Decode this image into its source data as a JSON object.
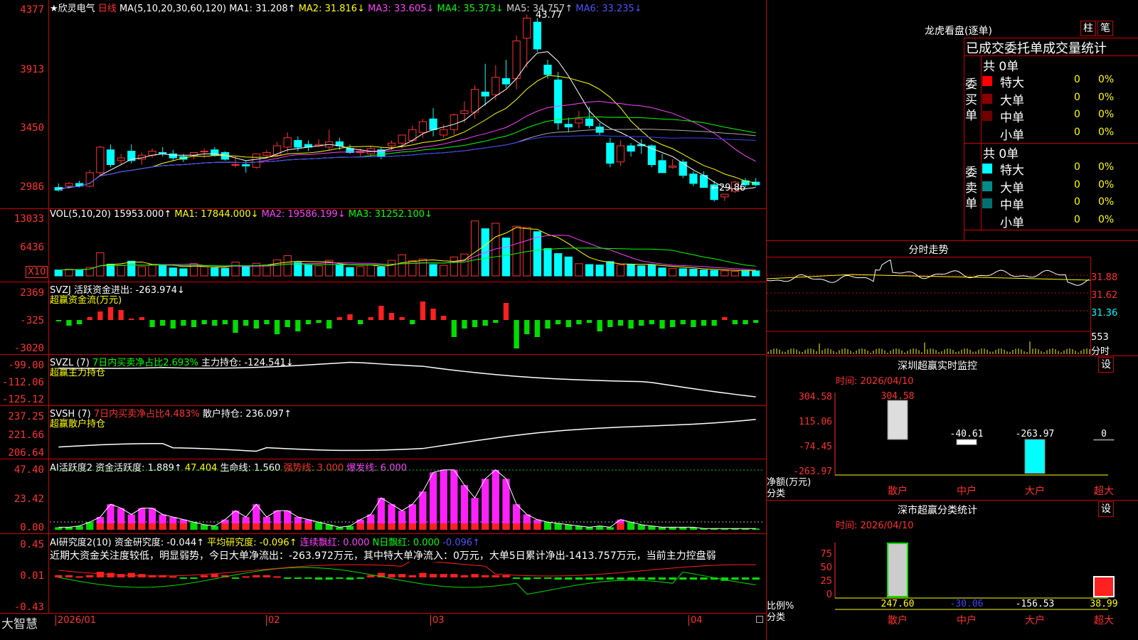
{
  "chart": {
    "stock_name": "★欣灵电气",
    "period": "日线",
    "ma_line": {
      "label": "MA(5,10,20,30,60,120)",
      "ma1": "MA1: 31.208↑",
      "ma2": "MA2: 31.816↓",
      "ma3": "MA3: 33.605↓",
      "ma4": "MA4: 35.373↓",
      "ma5": "MA5: 34.757↑",
      "ma6": "MA6: 33.235↓"
    },
    "high_mark": "43.77",
    "low_mark": "←29.86",
    "price_axis": [
      "4377",
      "3913",
      "3450",
      "2986"
    ],
    "vol_line": {
      "label": "VOL(5,10,20)",
      "v": "15953.000↑",
      "ma1": "MA1: 17844.000↓",
      "ma2": "MA2: 19586.199↓",
      "ma3": "MA3: 31252.100↓"
    },
    "vol_axis": [
      "13033",
      "6436",
      "X10"
    ],
    "svzj": {
      "label": "SVZJ",
      "desc": "活跃资金进出: -263.974↓",
      "sub": "超赢资金流(万元)",
      "axis": [
        "2369",
        "-325",
        "-3020"
      ]
    },
    "svzl": {
      "label": "SVZL (7)",
      "ratio": "7日内买卖净占比2.693%",
      "hold": "主力持仓: -124.541↓",
      "sub": "超赢主力持仓",
      "axis": [
        "-99.00",
        "-112.06",
        "-125.12"
      ]
    },
    "svsh": {
      "label": "SVSH (7)",
      "ratio": "7日内买卖净占比4.483%",
      "hold": "散户持仓: 236.097↑",
      "sub": "超赢散户持仓",
      "axis": [
        "237.25",
        "221.66",
        "206.64"
      ]
    },
    "ai_active": {
      "label": "AI活跃度2",
      "v1": "资金活跃度: 1.889↑",
      "v2": "47.404",
      "v3": "生命线: 1.560",
      "v4": "强势线: 3.000",
      "v5": "爆发线: 6.000",
      "axis": [
        "47.40",
        "23.42",
        "0.00"
      ]
    },
    "ai_research": {
      "label": "AI研究度2(10)",
      "v1": "资金研究度: -0.044↑",
      "v2": "平均研究度: -0.096↑",
      "v3": "连续飘红: 0.000",
      "v4": "N日飘红: 0.000",
      "v5": "-0.096↑",
      "axis": [
        "0.45",
        "0.01",
        "-0.43"
      ],
      "note": "近期大资金关注度较低，明显弱势，今日大单净流出：-263.972万元，其中特大单净流入：0万元，大单5日累计净出-1413.757万元，当前主力控盘弱"
    },
    "date_axis": [
      "2026/01",
      "02",
      "03",
      "04"
    ],
    "brand": "大智慧"
  },
  "right": {
    "dragon": {
      "title": "龙虎看盘(逐单)",
      "btn1": "柱",
      "btn2": "笔",
      "subtitle": "已成交委托单成交量统计",
      "buy": {
        "side": "委买单",
        "total": "共 0单",
        "rows": [
          {
            "label": "特大",
            "count": "0",
            "pct": "0%",
            "color": "#ff0000"
          },
          {
            "label": "大单",
            "count": "0",
            "pct": "0%",
            "color": "#8b0000"
          },
          {
            "label": "中单",
            "count": "0",
            "pct": "0%",
            "color": "#700000"
          },
          {
            "label": "小单",
            "count": "0",
            "pct": "0%",
            "color": "#000"
          }
        ]
      },
      "sell": {
        "side": "委卖单",
        "total": "共 0单",
        "rows": [
          {
            "label": "特大",
            "count": "0",
            "pct": "0%",
            "color": "#00ffff"
          },
          {
            "label": "大单",
            "count": "0",
            "pct": "0%",
            "color": "#008b8b"
          },
          {
            "label": "中单",
            "count": "0",
            "pct": "0%",
            "color": "#007070"
          },
          {
            "label": "小单",
            "count": "0",
            "pct": "0%",
            "color": "#000"
          }
        ]
      }
    },
    "intraday": {
      "title": "分时走势",
      "axis": [
        "31.88",
        "31.62",
        "31.36"
      ],
      "vol": "553",
      "vol_label": "分时"
    },
    "sz_monitor": {
      "title": "深圳超赢实时监控",
      "btn": "设",
      "time": "时间: 2026/04/10",
      "axis": [
        "304.58",
        "115.06",
        "-74.45",
        "-263.97"
      ],
      "values": [
        {
          "cat": "散户",
          "v": 304.58,
          "label": "304.58"
        },
        {
          "cat": "中户",
          "v": -40.61,
          "label": "-40.61"
        },
        {
          "cat": "大户",
          "v": -263.97,
          "label": "-263.97"
        },
        {
          "cat": "超大",
          "v": 0,
          "label": "0"
        }
      ],
      "ylabel": "净额(万元)",
      "xlabel": "分类"
    },
    "sz_category": {
      "title": "深市超赢分类统计",
      "btn": "设",
      "time": "时间: 2026/04/10",
      "axis": [
        "75",
        "50",
        "25",
        "0"
      ],
      "values": [
        {
          "cat": "散户",
          "v": 247.6,
          "label": "247.60"
        },
        {
          "cat": "中户",
          "v": -30.06,
          "label": "-30.06"
        },
        {
          "cat": "大户",
          "v": -156.53,
          "label": "-156.53"
        },
        {
          "cat": "超大",
          "v": 38.99,
          "label": "38.99"
        }
      ],
      "ylabel": "比例%",
      "xlabel": "分类"
    }
  },
  "chart_data": [
    {
      "type": "candlestick",
      "title": "欣灵电气 日线",
      "ohlc": [
        [
          30.9,
          31.2,
          30.6,
          30.7
        ],
        [
          31.0,
          31.3,
          30.8,
          31.2
        ],
        [
          31.2,
          31.4,
          30.9,
          31.0
        ],
        [
          31.0,
          32.2,
          30.9,
          32.0
        ],
        [
          32.0,
          34.0,
          31.8,
          33.9
        ],
        [
          33.7,
          34.1,
          32.4,
          32.6
        ],
        [
          32.9,
          33.4,
          32.6,
          33.1
        ],
        [
          33.6,
          34.1,
          32.7,
          32.9
        ],
        [
          33.0,
          33.5,
          32.6,
          33.3
        ],
        [
          33.3,
          33.8,
          33.1,
          33.6
        ],
        [
          33.5,
          33.9,
          33.2,
          33.4
        ],
        [
          33.4,
          33.7,
          32.9,
          33.1
        ],
        [
          33.2,
          33.4,
          32.8,
          33.0
        ],
        [
          33.3,
          33.5,
          33.0,
          33.5
        ],
        [
          33.6,
          33.8,
          33.1,
          33.6
        ],
        [
          33.7,
          33.9,
          33.2,
          33.3
        ],
        [
          33.5,
          33.6,
          32.9,
          33.0
        ],
        [
          32.6,
          33.2,
          32.4,
          32.6
        ],
        [
          32.6,
          32.9,
          32.0,
          32.5
        ],
        [
          32.4,
          33.4,
          32.3,
          33.4
        ],
        [
          33.3,
          33.7,
          33.1,
          33.5
        ],
        [
          33.3,
          34.3,
          33.2,
          34.0
        ],
        [
          33.9,
          35.0,
          33.5,
          34.6
        ],
        [
          34.4,
          34.7,
          33.6,
          33.9
        ],
        [
          34.1,
          34.4,
          33.6,
          33.9
        ],
        [
          34.0,
          34.5,
          33.9,
          34.1
        ],
        [
          33.9,
          35.2,
          33.7,
          34.3
        ],
        [
          34.3,
          34.6,
          33.7,
          34.0
        ],
        [
          33.8,
          34.1,
          33.4,
          33.5
        ],
        [
          33.5,
          33.8,
          33.2,
          33.6
        ],
        [
          33.4,
          34.0,
          33.2,
          33.8
        ],
        [
          33.7,
          33.9,
          33.0,
          33.2
        ],
        [
          34.0,
          34.4,
          33.7,
          34.2
        ],
        [
          34.2,
          34.8,
          33.8,
          34.8
        ],
        [
          34.4,
          35.5,
          34.2,
          35.2
        ],
        [
          35.0,
          36.0,
          34.6,
          35.8
        ],
        [
          36.0,
          36.8,
          34.7,
          35.2
        ],
        [
          34.8,
          35.6,
          34.6,
          35.2
        ],
        [
          35.2,
          36.4,
          34.8,
          36.3
        ],
        [
          36.4,
          37.3,
          35.7,
          36.6
        ],
        [
          36.5,
          38.5,
          36.0,
          38.2
        ],
        [
          38.0,
          40.1,
          37.0,
          37.7
        ],
        [
          37.8,
          40.0,
          37.4,
          39.1
        ],
        [
          39.0,
          40.4,
          38.3,
          38.6
        ],
        [
          39.0,
          42.2,
          38.2,
          41.8
        ],
        [
          42.0,
          43.77,
          39.8,
          43.5
        ],
        [
          43.2,
          43.5,
          41.0,
          41.2
        ],
        [
          40.0,
          40.4,
          39.0,
          39.3
        ],
        [
          38.9,
          39.5,
          35.2,
          35.7
        ],
        [
          35.6,
          36.1,
          35.0,
          35.4
        ],
        [
          35.7,
          36.6,
          35.3,
          36.0
        ],
        [
          36.0,
          36.9,
          35.3,
          35.5
        ],
        [
          35.4,
          35.7,
          34.8,
          35.0
        ],
        [
          34.2,
          34.6,
          32.4,
          32.7
        ],
        [
          32.8,
          34.4,
          32.5,
          34.0
        ],
        [
          34.0,
          34.2,
          33.2,
          33.6
        ],
        [
          34.1,
          34.5,
          33.4,
          34.0
        ],
        [
          34.0,
          34.1,
          32.4,
          32.6
        ],
        [
          32.9,
          33.4,
          32.0,
          32.0
        ],
        [
          32.4,
          33.0,
          32.3,
          32.5
        ],
        [
          32.8,
          33.0,
          31.6,
          31.8
        ],
        [
          31.9,
          32.1,
          31.0,
          31.2
        ],
        [
          31.8,
          32.1,
          30.9,
          30.9
        ],
        [
          31.1,
          31.4,
          29.86,
          30.0
        ],
        [
          30.2,
          30.4,
          29.9,
          30.4
        ],
        [
          30.6,
          31.4,
          30.5,
          31.3
        ],
        [
          31.4,
          31.6,
          30.9,
          31.1
        ],
        [
          31.3,
          31.6,
          31.0,
          31.1
        ]
      ],
      "ma": {
        "MA1": [
          30.8,
          30.9,
          31.0,
          31.2,
          31.8,
          32.2,
          32.6,
          33.0,
          33.1,
          33.3,
          33.4,
          33.3,
          33.3,
          33.3,
          33.4,
          33.4,
          33.3,
          33.1,
          32.9,
          33.0,
          33.1,
          33.4,
          33.7,
          33.8,
          33.9,
          34.0,
          34.1,
          34.0,
          33.8,
          33.7,
          33.6,
          33.6,
          33.8,
          34.0,
          34.4,
          34.9,
          35.2,
          35.4,
          35.6,
          35.9,
          36.5,
          37.1,
          37.7,
          38.2,
          39.0,
          40.1,
          40.9,
          41.0,
          40.3,
          39.2,
          37.9,
          36.6,
          35.8,
          35.3,
          35.0,
          34.6,
          34.1,
          33.8,
          33.5,
          33.2,
          32.7,
          32.2,
          31.8,
          31.3,
          30.9,
          30.8,
          30.8,
          30.9
        ]
      },
      "volume": [
        1400,
        1600,
        1500,
        2000,
        5500,
        2800,
        2500,
        3500,
        2200,
        2700,
        2500,
        1900,
        1700,
        2900,
        2200,
        1900,
        1800,
        3300,
        2100,
        3000,
        2600,
        3800,
        4800,
        3200,
        2600,
        2400,
        3700,
        2600,
        2000,
        2200,
        2600,
        2100,
        3700,
        5000,
        3600,
        4000,
        2700,
        2500,
        4500,
        5200,
        13033,
        11200,
        12500,
        9000,
        11800,
        11500,
        10500,
        6500,
        5300,
        4500,
        2900,
        2700,
        2600,
        3400,
        2600,
        2700,
        2400,
        2600,
        1900,
        1800,
        1700,
        1600,
        1400,
        1300,
        1200,
        1100,
        1300,
        1200
      ]
    }
  ]
}
